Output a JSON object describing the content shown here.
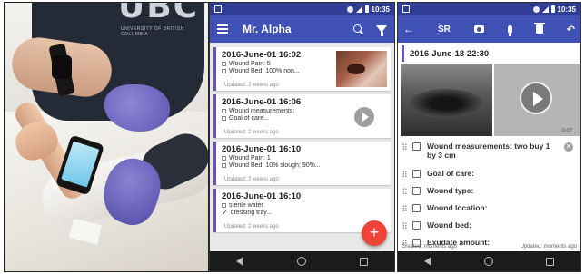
{
  "photo": {
    "shirt_text": "UBC",
    "shirt_subtext": "UNIVERSITY OF BRITISH COLUMBIA"
  },
  "colors": {
    "primary": "#3f51b5",
    "status_bar": "#2f3d97",
    "card_accent": "#6b4fbf",
    "fab": "#f04438"
  },
  "middle_screen": {
    "status_time": "10:35",
    "title": "Mr. Alpha",
    "icons": [
      "menu-icon",
      "search-icon",
      "filter-icon"
    ],
    "entries": [
      {
        "title": "2016-June-01 16:02",
        "lines": [
          "Wound Pain: 5",
          "Wound Bed: 100% non..."
        ],
        "line_marks": [
          "box",
          "box"
        ],
        "updated": "Updated: 2 weeks ago",
        "media": "photo"
      },
      {
        "title": "2016-June-01 16:06",
        "lines": [
          "Wound measurements:",
          "Goal of care..."
        ],
        "line_marks": [
          "box",
          "box"
        ],
        "updated": "Updated: 2 weeks ago",
        "media": "video"
      },
      {
        "title": "2016-June-01 16:10",
        "lines": [
          "Wound Pain: 1",
          "Wound Bed: 10% slough; 90%..."
        ],
        "line_marks": [
          "box",
          "box"
        ],
        "updated": "Updated: 2 weeks ago",
        "media": "none"
      },
      {
        "title": "2016-June-01 16:10",
        "lines": [
          "sterile water",
          "dressing tray..."
        ],
        "line_marks": [
          "box",
          "check"
        ],
        "updated": "Updated: 2 weeks ago",
        "media": "none"
      }
    ],
    "fab_label": "+"
  },
  "right_screen": {
    "status_time": "10:35",
    "toolbar": {
      "back": "←",
      "sr_label": "SR",
      "undo": "↶"
    },
    "entry_title": "2016-June-18 22:30",
    "video_time": "0:07",
    "checklist": [
      {
        "label": "Wound measurements: two buy 1 by 3 cm",
        "has_clear": true
      },
      {
        "label": "Goal of care:",
        "has_clear": false
      },
      {
        "label": "Wound type:",
        "has_clear": false
      },
      {
        "label": "Wound location:",
        "has_clear": false
      },
      {
        "label": "Wound bed:",
        "has_clear": false
      },
      {
        "label": "Exudate amount:",
        "has_clear": false
      }
    ],
    "clear_label": "✕",
    "created": "Created: moments ago",
    "updated": "Updated: moments ago"
  }
}
